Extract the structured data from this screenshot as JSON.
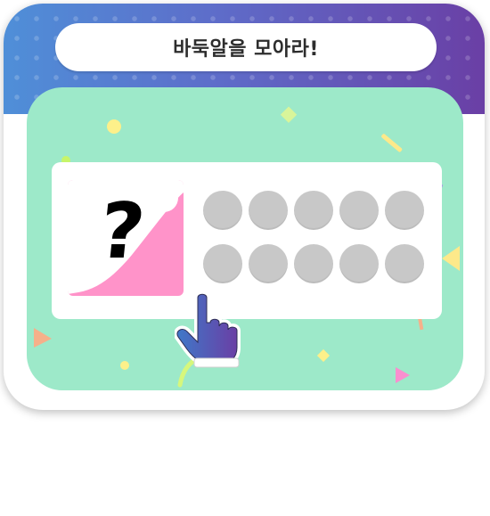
{
  "title": "바둑알을 모아라!",
  "mystery_card": {
    "symbol": "?",
    "color": "#ff93c9"
  },
  "stones": {
    "rows": 2,
    "columns": 5,
    "collected": 0,
    "total": 10,
    "empty_color": "#c8c8c8"
  },
  "colors": {
    "header_gradient_start": "#4f8fd8",
    "header_gradient_end": "#6a3fa5",
    "play_area": "#9de9c9",
    "board": "#ffffff"
  },
  "icons": {
    "pointer": "pointing-hand-icon"
  }
}
